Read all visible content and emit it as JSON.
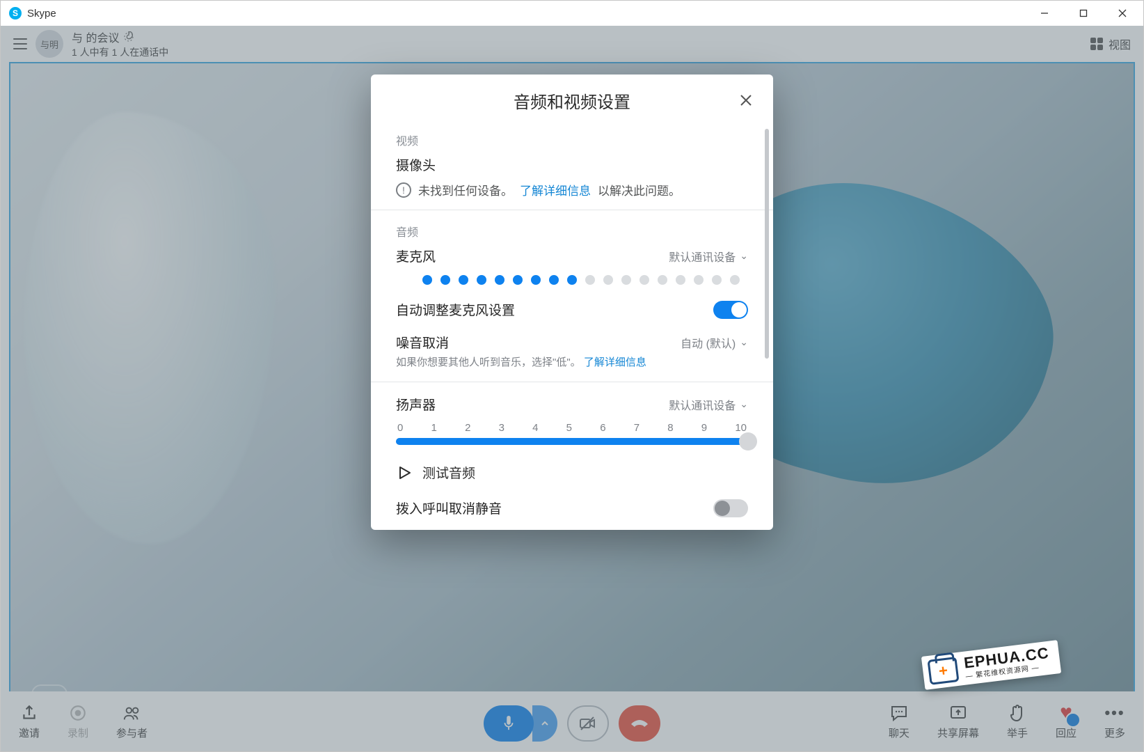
{
  "window": {
    "app_name": "Skype"
  },
  "header": {
    "avatar_text": "与明",
    "meeting_title": "与          的会议",
    "sub": "1 人中有 1 人在通话中",
    "view_label": "视图"
  },
  "bottombar": {
    "left": [
      {
        "key": "invite",
        "label": "邀请"
      },
      {
        "key": "record",
        "label": "录制"
      },
      {
        "key": "participants",
        "label": "参与者"
      }
    ],
    "right": [
      {
        "key": "chat",
        "label": "聊天"
      },
      {
        "key": "share",
        "label": "共享屏幕"
      },
      {
        "key": "raise",
        "label": "举手"
      },
      {
        "key": "react",
        "label": "回应"
      },
      {
        "key": "more",
        "label": "更多"
      }
    ]
  },
  "modal": {
    "title": "音频和视频设置",
    "video": {
      "section": "视频",
      "camera_label": "摄像头",
      "not_found_prefix": "未找到任何设备。",
      "learn_more": "了解详细信息",
      "not_found_suffix": "以解决此问题。"
    },
    "audio": {
      "section": "音频",
      "microphone_label": "麦克风",
      "default_device": "默认通讯设备",
      "mic_level_active": 9,
      "mic_level_total": 18,
      "auto_adjust": "自动调整麦克风设置",
      "auto_adjust_on": true,
      "noise_cancel": "噪音取消",
      "noise_cancel_value": "自动 (默认)",
      "noise_cancel_sub_prefix": "如果你想要其他人听到音乐，选择\"低\"。",
      "noise_cancel_link": "了解详细信息",
      "speaker_label": "扬声器",
      "speaker_device": "默认通讯设备",
      "slider_labels": [
        "0",
        "1",
        "2",
        "3",
        "4",
        "5",
        "6",
        "7",
        "8",
        "9",
        "10"
      ],
      "slider_value": 10,
      "test_audio": "测试音频",
      "unmute_incoming": "拨入呼叫取消静音",
      "unmute_incoming_on": false
    }
  },
  "watermark": {
    "line1": "EPHUA.CC",
    "line2": "— 繁花维权资源网 —"
  }
}
